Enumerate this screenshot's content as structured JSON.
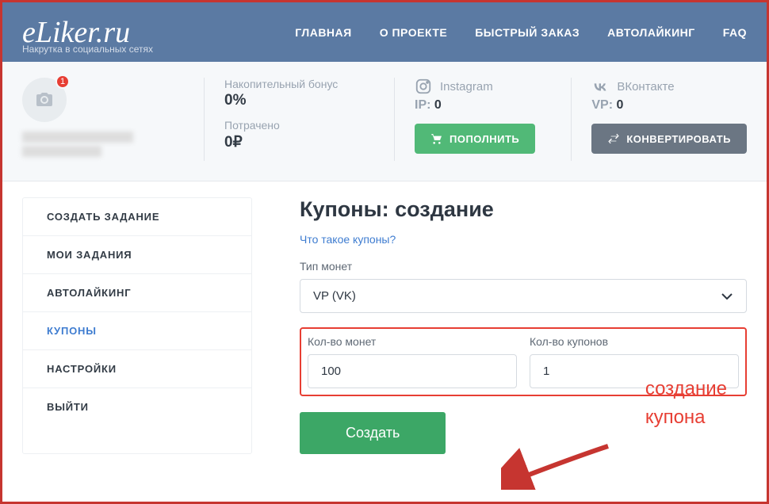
{
  "header": {
    "logo": "eLiker.ru",
    "tagline": "Накрутка в социальных сетях",
    "nav": [
      "ГЛАВНАЯ",
      "О ПРОЕКТЕ",
      "БЫСТРЫЙ ЗАКАЗ",
      "АВТОЛАЙКИНГ",
      "FAQ"
    ]
  },
  "stats": {
    "avatar_badge": "1",
    "bonus_label": "Накопительный бонус",
    "bonus_value": "0%",
    "spent_label": "Потрачено",
    "spent_value": "0₽",
    "instagram_name": "Instagram",
    "instagram_points_label": "IP:",
    "instagram_points_value": "0",
    "vk_name": "ВКонтакте",
    "vk_points_label": "VP:",
    "vk_points_value": "0",
    "topup_btn": "ПОПОЛНИТЬ",
    "convert_btn": "КОНВЕРТИРОВАТЬ"
  },
  "sidebar": {
    "items": [
      "СОЗДАТЬ ЗАДАНИЕ",
      "МОИ ЗАДАНИЯ",
      "АВТОЛАЙКИНГ",
      "КУПОНЫ",
      "НАСТРОЙКИ",
      "ВЫЙТИ"
    ],
    "active_index": 3
  },
  "content": {
    "title": "Купоны: создание",
    "help_link": "Что такое купоны?",
    "coin_type_label": "Тип монет",
    "coin_type_value": "VP (VK)",
    "coins_label": "Кол-во монет",
    "coins_value": "100",
    "coupons_label": "Кол-во купонов",
    "coupons_value": "1",
    "create_btn": "Создать"
  },
  "annotation": {
    "line1": "создание",
    "line2": "купона"
  }
}
